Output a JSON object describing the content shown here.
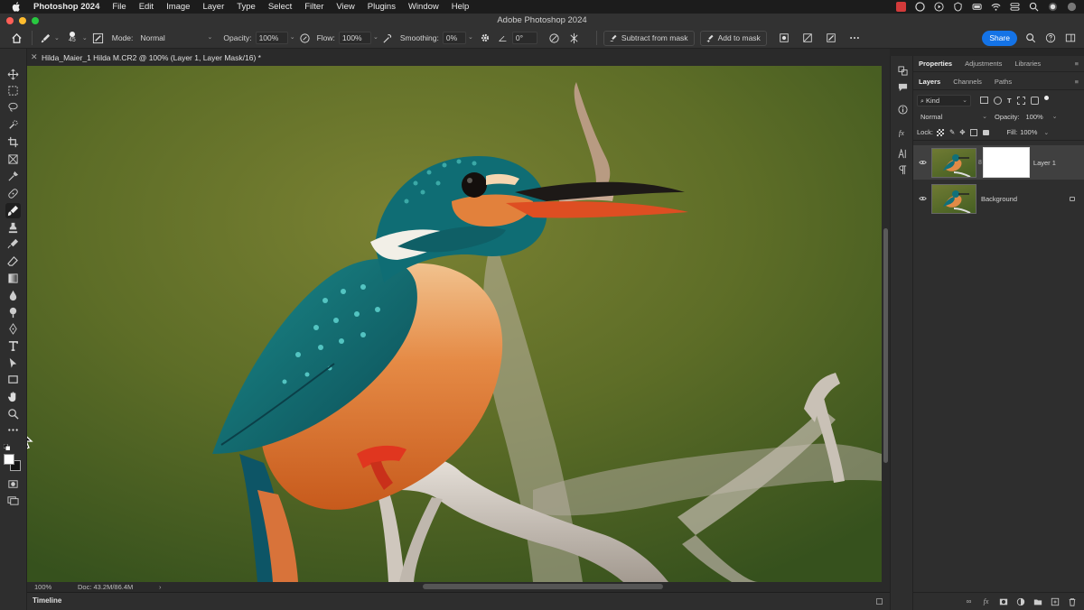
{
  "menubar": {
    "app_name": "Photoshop 2024",
    "items": [
      "File",
      "Edit",
      "Image",
      "Layer",
      "Type",
      "Select",
      "Filter",
      "View",
      "Plugins",
      "Window",
      "Help"
    ]
  },
  "window": {
    "title": "Adobe Photoshop 2024"
  },
  "options_bar": {
    "brush_size": "45",
    "mode_label": "Mode:",
    "mode_value": "Normal",
    "opacity_label": "Opacity:",
    "opacity_value": "100%",
    "flow_label": "Flow:",
    "flow_value": "100%",
    "smoothing_label": "Smoothing:",
    "smoothing_value": "0%",
    "angle_value": "0°",
    "subtract_mask_label": "Subtract from mask",
    "add_mask_label": "Add to mask",
    "share_label": "Share"
  },
  "document": {
    "tab_title": "Hilda_Maier_1 Hilda M.CR2 @ 100% (Layer 1, Layer Mask/16) *",
    "zoom": "100%",
    "doc_size": "Doc: 43.2M/86.4M",
    "timeline_label": "Timeline"
  },
  "panels": {
    "top_tabs": [
      "Properties",
      "Adjustments",
      "Libraries"
    ],
    "layer_tabs": [
      "Layers",
      "Channels",
      "Paths"
    ],
    "filter_kind": "Kind",
    "blend_mode": "Normal",
    "opacity_label": "Opacity:",
    "opacity_value": "100%",
    "lock_label": "Lock:",
    "fill_label": "Fill:",
    "fill_value": "100%",
    "layers": [
      {
        "name": "Layer 1",
        "selected": true
      },
      {
        "name": "Background",
        "selected": false
      }
    ]
  },
  "colors": {
    "accent": "#1473e6",
    "traffic_close": "#ff5f57",
    "traffic_min": "#febc2e",
    "traffic_max": "#28c840"
  }
}
